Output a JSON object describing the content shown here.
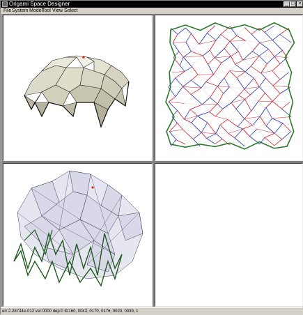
{
  "window": {
    "title": "Origami Space Designer"
  },
  "menu": [
    "File",
    "System",
    "Model",
    "Tool",
    "View",
    "Select"
  ],
  "titlebar_buttons": {
    "minimize": "_",
    "maximize": "□",
    "close": "×"
  },
  "status_bar": {
    "text": "err:2.28744e-012   ver:0000 dep:0 ID160, 0043, 0170, 0176, 0023, 0339, 1"
  },
  "colors": {
    "mountain_fold": "#c8202a",
    "valley_fold": "#2030a8",
    "boundary": "#2a7a2a",
    "surface": "#e6e4d2",
    "selected_vertex": "#e02020"
  },
  "panes": [
    {
      "name": "3d-folded-view",
      "content": "folded origami shell"
    },
    {
      "name": "crease-pattern-view",
      "content": "crease pattern"
    },
    {
      "name": "transparent-3d-view",
      "content": "transparent folded model"
    },
    {
      "name": "empty-view",
      "content": ""
    }
  ]
}
